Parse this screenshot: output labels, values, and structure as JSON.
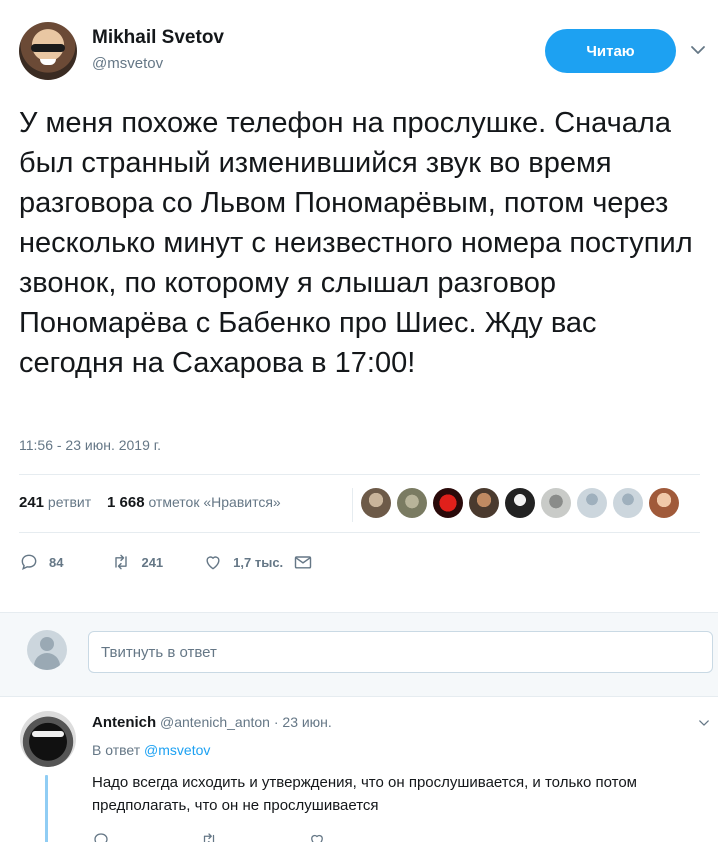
{
  "tweet": {
    "author_name": "Mikhail Svetov",
    "author_handle": "@msvetov",
    "follow_button": "Читаю",
    "text": "У меня похоже телефон на прослушке. Сначала был странный изменившийся звук во время разговора со Львом Пономарёвым, потом через несколько минут с неизвестного номера поступил звонок, по которому я слышал разговор Пономарёва с Бабенко про Шиес. Жду вас сегодня на Сахарова в 17:00!",
    "timestamp": "11:56 - 23 июн. 2019 г.",
    "retweets_count": "241",
    "retweets_label": "ретвит",
    "likes_count": "1 668",
    "likes_label": "отметок «Нравится»",
    "actions": {
      "reply_count": "84",
      "retweet_count": "241",
      "like_count": "1,7 тыс."
    }
  },
  "composer": {
    "placeholder": "Твитнуть в ответ"
  },
  "reply": {
    "author_name": "Antenich",
    "meta": "@antenich_anton · 23 июн.",
    "reply_to_label": "В ответ",
    "reply_to_handle": "@msvetov",
    "text": "Надо всегда исходить и утверждения, что он прослушивается, и только потом предполагать, что он не прослушивается"
  },
  "colors": {
    "accent": "#1da1f2",
    "text": "#14171a",
    "secondary": "#657786",
    "band": "#f5f8fa"
  }
}
